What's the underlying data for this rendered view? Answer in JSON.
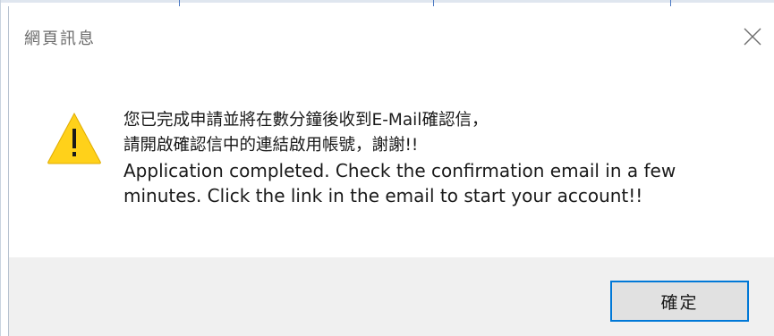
{
  "dialog": {
    "title": "網頁訊息",
    "close_icon": "close-icon",
    "warning_icon": "warning-icon",
    "message_lines": [
      "您已完成申請並將在數分鐘後收到E-Mail確認信，",
      "請開啟確認信中的連結啟用帳號，謝謝!!",
      "Application completed. Check the confirmation email in a few",
      "minutes. Click the link in the email to start your account!!"
    ],
    "ok_label": "確定"
  },
  "colors": {
    "accent_border": "#0078d7",
    "warning_fill": "#ffd11a",
    "footer_bg": "#f0f0f0"
  }
}
